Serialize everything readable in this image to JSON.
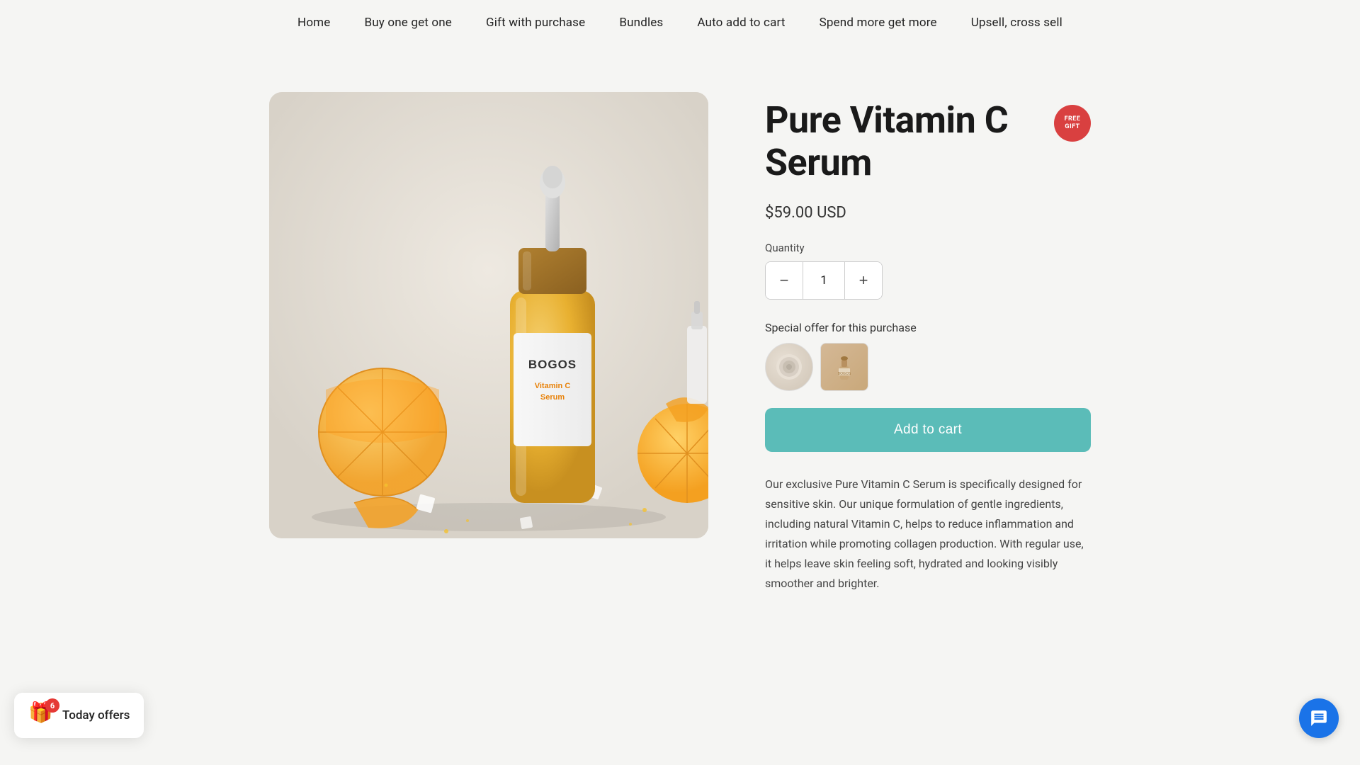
{
  "nav": {
    "items": [
      {
        "label": "Home",
        "href": "#"
      },
      {
        "label": "Buy one get one",
        "href": "#"
      },
      {
        "label": "Gift with purchase",
        "href": "#"
      },
      {
        "label": "Bundles",
        "href": "#"
      },
      {
        "label": "Auto add to cart",
        "href": "#"
      },
      {
        "label": "Spend more get more",
        "href": "#"
      },
      {
        "label": "Upsell, cross sell",
        "href": "#"
      }
    ]
  },
  "product": {
    "title": "Pure Vitamin C Serum",
    "price": "$59.00 USD",
    "quantity": "1",
    "quantity_label": "Quantity",
    "special_offer_label": "Special offer for this purchase",
    "add_to_cart_label": "Add to cart",
    "description": "Our exclusive Pure Vitamin C Serum is specifically designed for sensitive skin. Our unique formulation of gentle ingredients, including natural Vitamin C, helps to reduce inflammation and irritation while promoting collagen production. With regular use, it helps leave skin feeling soft, hydrated and looking visibly smoother and brighter.",
    "badge_line1": "FREE",
    "badge_line2": "GIFT"
  },
  "today_offers": {
    "label": "Today offers",
    "badge_count": "6"
  },
  "icons": {
    "gift": "🎁",
    "minus": "−",
    "plus": "+"
  }
}
